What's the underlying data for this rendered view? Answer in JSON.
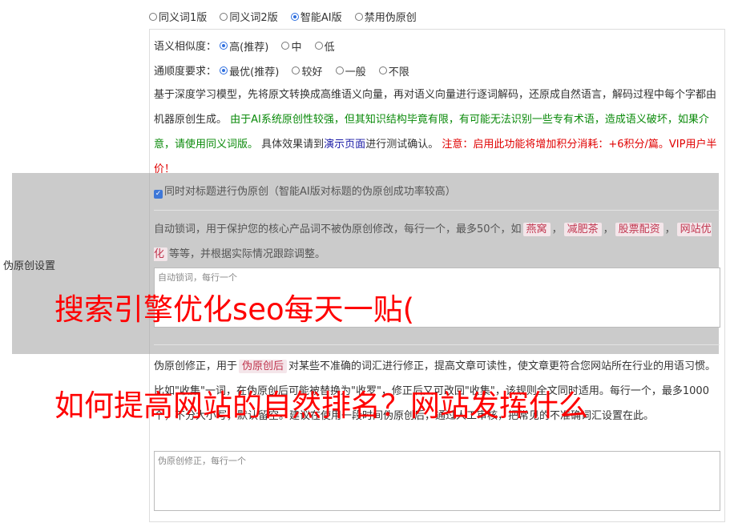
{
  "version_options": [
    {
      "label": "同义词1版",
      "selected": false
    },
    {
      "label": "同义词2版",
      "selected": false
    },
    {
      "label": "智能AI版",
      "selected": true
    },
    {
      "label": "禁用伪原创",
      "selected": false
    }
  ],
  "similarity": {
    "label": "语义相似度：",
    "options": [
      {
        "label": "高(推荐)",
        "selected": true
      },
      {
        "label": "中",
        "selected": false
      },
      {
        "label": "低",
        "selected": false
      }
    ]
  },
  "fluency": {
    "label": "通顺度要求：",
    "options": [
      {
        "label": "最优(推荐)",
        "selected": true
      },
      {
        "label": "较好",
        "selected": false
      },
      {
        "label": "一般",
        "selected": false
      },
      {
        "label": "不限",
        "selected": false
      }
    ]
  },
  "description": {
    "part1": "基于深度学习模型，先将原文转换成高维语义向量，再对语义向量进行逐词解码，还原成自然语言，解码过程中每个字都由机器原创生成。",
    "part2_green": "由于AI系统原创性较强，但其知识结构毕竟有限，有可能无法识别一些专有术语，造成语义破坏，如果介意，请使用同义词版。",
    "part3": "具体效果请到",
    "link": "演示页面",
    "part4": "进行测试确认。",
    "warn": "注意：启用此功能将增加积分消耗：+6积分/篇。VIP用户半价！"
  },
  "side_label": "伪原创设置",
  "title_checkbox": "同时对标题进行伪原创（智能AI版对标题的伪原创成功率较高）",
  "lock": {
    "text_before": "自动锁词，用于保护您的核心产品词不被伪原创修改，每行一个，最多50个，如",
    "tags": [
      "燕窝",
      "减肥茶",
      "股票配资",
      "网站优化"
    ],
    "text_after": "等等，并根据实际情况跟踪调整。",
    "placeholder": "自动锁词，每行一个"
  },
  "fix": {
    "text1": "伪原创修正，用于",
    "tag": "伪原创后",
    "text2": "对某些不准确的词汇进行修正，提高文章可读性，使文章更符合您网站所在行业的用语习惯。比如\"收集\"一词，在伪原创后可能被替换为\"收罗\"，修正后又可改回\"收集\"，该规则全文同时适用。每行一个，最多1000个，不分大小写，默认留空。建议在使用一段时间伪原创后，通过人工审核，把常见的不准确词汇设置在此。",
    "placeholder": "伪原创修正，每行一个"
  },
  "overlay": {
    "line1": "搜索引擎优化seo每天一贴(",
    "line2": "如何提高网站的自然排名？网站发挥什么"
  }
}
